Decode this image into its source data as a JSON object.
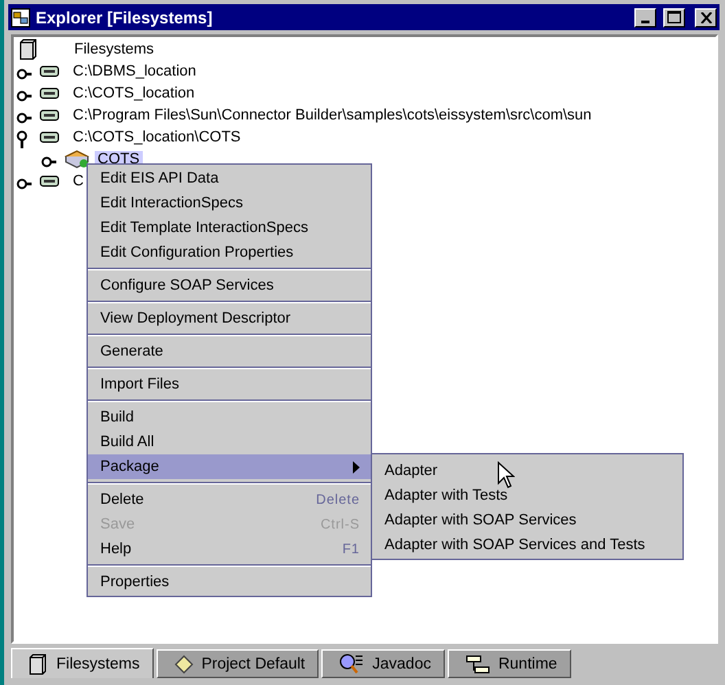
{
  "window": {
    "title": "Explorer [Filesystems]"
  },
  "tree": {
    "label": "Filesystems",
    "children": [
      {
        "label": "C:\\DBMS_location",
        "expanded": false,
        "selected": false
      },
      {
        "label": "C:\\COTS_location",
        "expanded": false,
        "selected": false
      },
      {
        "label": "C:\\Program Files\\Sun\\Connector Builder\\samples\\cots\\eissystem\\src\\com\\sun",
        "expanded": false,
        "selected": false
      },
      {
        "label": "C:\\COTS_location\\COTS",
        "expanded": true,
        "selected": false,
        "children": [
          {
            "label": "COTS",
            "expanded": false,
            "selected": true,
            "kind": "package"
          }
        ]
      },
      {
        "label": "C",
        "expanded": false,
        "selected": false
      }
    ]
  },
  "context_menu": [
    {
      "kind": "item",
      "label": "Edit EIS API Data",
      "disabled": false,
      "selected": false
    },
    {
      "kind": "item",
      "label": "Edit InteractionSpecs",
      "disabled": false,
      "selected": false
    },
    {
      "kind": "item",
      "label": "Edit Template InteractionSpecs",
      "disabled": false,
      "selected": false
    },
    {
      "kind": "item",
      "label": "Edit Configuration Properties",
      "disabled": false,
      "selected": false
    },
    {
      "kind": "separator"
    },
    {
      "kind": "item",
      "label": "Configure SOAP Services",
      "disabled": false,
      "selected": false
    },
    {
      "kind": "separator"
    },
    {
      "kind": "item",
      "label": "View Deployment Descriptor",
      "disabled": false,
      "selected": false
    },
    {
      "kind": "separator"
    },
    {
      "kind": "item",
      "label": "Generate",
      "disabled": false,
      "selected": false
    },
    {
      "kind": "separator"
    },
    {
      "kind": "item",
      "label": "Import Files",
      "disabled": false,
      "selected": false
    },
    {
      "kind": "separator"
    },
    {
      "kind": "item",
      "label": "Build",
      "disabled": false,
      "selected": false
    },
    {
      "kind": "item",
      "label": "Build All",
      "disabled": false,
      "selected": false
    },
    {
      "kind": "submenu",
      "label": "Package",
      "disabled": false,
      "selected": true,
      "expanded": true
    },
    {
      "kind": "separator"
    },
    {
      "kind": "item",
      "label": "Delete",
      "shortcut": "Delete",
      "disabled": false,
      "selected": false
    },
    {
      "kind": "item",
      "label": "Save",
      "shortcut": "Ctrl-S",
      "disabled": true,
      "selected": false
    },
    {
      "kind": "item",
      "label": "Help",
      "shortcut": "F1",
      "disabled": false,
      "selected": false
    },
    {
      "kind": "separator"
    },
    {
      "kind": "item",
      "label": "Properties",
      "disabled": false,
      "selected": false
    }
  ],
  "submenu": [
    {
      "label": "Adapter"
    },
    {
      "label": "Adapter with Tests"
    },
    {
      "label": "Adapter with SOAP Services"
    },
    {
      "label": "Adapter with SOAP Services and Tests"
    }
  ],
  "tabs": [
    {
      "label": "Filesystems",
      "selected": true,
      "kind": "filesystems"
    },
    {
      "label": "Project Default",
      "selected": false,
      "kind": "project"
    },
    {
      "label": "Javadoc",
      "selected": false,
      "kind": "javadoc"
    },
    {
      "label": "Runtime",
      "selected": false,
      "kind": "runtime"
    }
  ]
}
